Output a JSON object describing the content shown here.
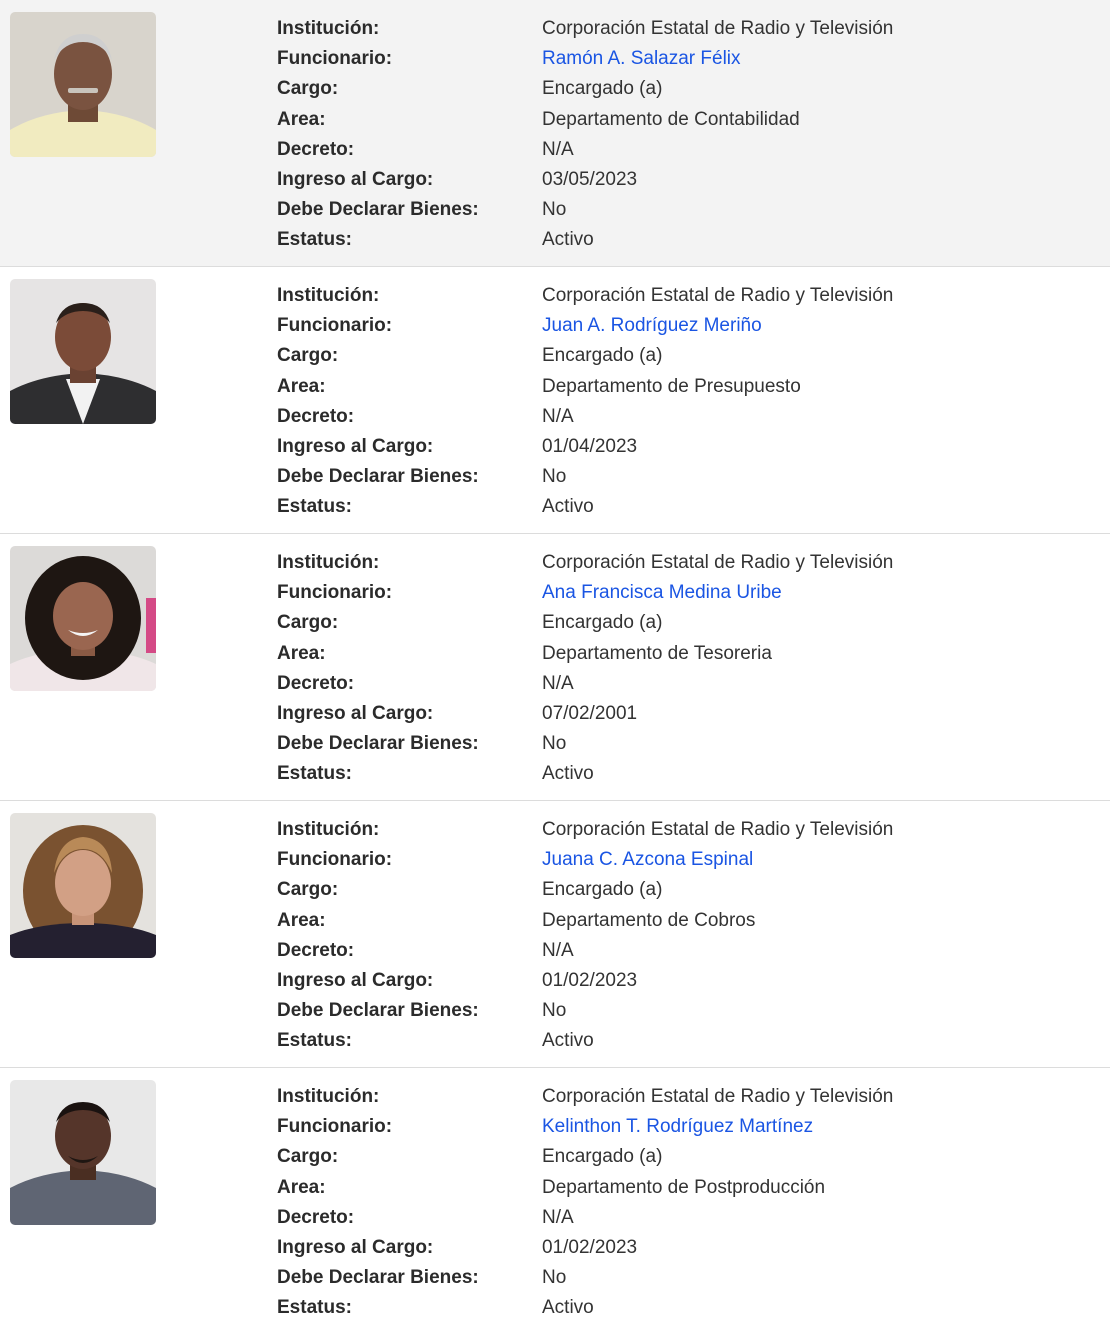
{
  "labels": {
    "institucion": "Institución:",
    "funcionario": "Funcionario:",
    "cargo": "Cargo:",
    "area": "Area:",
    "decreto": "Decreto:",
    "ingreso": "Ingreso al Cargo:",
    "declarar": "Debe Declarar Bienes:",
    "estatus": "Estatus:"
  },
  "colors": {
    "link": "#1a55e3",
    "alt_row_bg": "#f3f3f3"
  },
  "officials": [
    {
      "institucion": "Corporación Estatal de Radio y Televisión",
      "funcionario": "Ramón A. Salazar Félix",
      "cargo": "Encargado (a)",
      "area": "Departamento de Contabilidad",
      "decreto": "N/A",
      "ingreso": "03/05/2023",
      "declarar": "No",
      "estatus": "Activo"
    },
    {
      "institucion": "Corporación Estatal de Radio y Televisión",
      "funcionario": "Juan A. Rodríguez Meriño",
      "cargo": "Encargado (a)",
      "area": "Departamento de Presupuesto",
      "decreto": "N/A",
      "ingreso": "01/04/2023",
      "declarar": "No",
      "estatus": "Activo"
    },
    {
      "institucion": "Corporación Estatal de Radio y Televisión",
      "funcionario": "Ana Francisca Medina Uribe",
      "cargo": "Encargado (a)",
      "area": "Departamento de Tesoreria",
      "decreto": "N/A",
      "ingreso": "07/02/2001",
      "declarar": "No",
      "estatus": "Activo"
    },
    {
      "institucion": "Corporación Estatal de Radio y Televisión",
      "funcionario": "Juana C. Azcona Espinal",
      "cargo": "Encargado (a)",
      "area": "Departamento de Cobros",
      "decreto": "N/A",
      "ingreso": "01/02/2023",
      "declarar": "No",
      "estatus": "Activo"
    },
    {
      "institucion": "Corporación Estatal de Radio y Televisión",
      "funcionario": "Kelinthon T. Rodríguez Martínez",
      "cargo": "Encargado (a)",
      "area": "Departamento de Postproducción",
      "decreto": "N/A",
      "ingreso": "01/02/2023",
      "declarar": "No",
      "estatus": "Activo"
    }
  ]
}
